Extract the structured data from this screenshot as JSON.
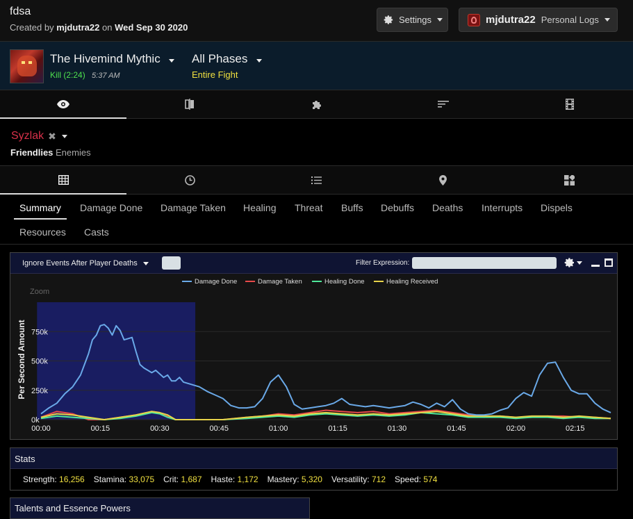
{
  "header": {
    "title": "fdsa",
    "created_prefix": "Created by",
    "created_user": "mjdutra22",
    "created_on": "on",
    "created_date": "Wed Sep 30 2020",
    "settings_label": "Settings",
    "user_name": "mjdutra22",
    "user_sub": "Personal Logs"
  },
  "fight": {
    "boss": "The Hivemind Mythic",
    "result": "Kill (2:24)",
    "time": "5:37 AM",
    "phase": "All Phases",
    "phase_sub": "Entire Fight"
  },
  "view_tabs": [
    "eye-icon",
    "compare-icon",
    "puzzle-icon",
    "sort-icon",
    "film-icon"
  ],
  "actor": {
    "name": "Syzlak",
    "friendlies": "Friendlies",
    "enemies": "Enemies"
  },
  "sub_tabs": [
    "grid-icon",
    "clock-icon",
    "list-icon",
    "map-marker-icon",
    "widgets-icon"
  ],
  "report_tabs": {
    "summary": "Summary",
    "damage_done": "Damage Done",
    "damage_taken": "Damage Taken",
    "healing": "Healing",
    "threat": "Threat",
    "buffs": "Buffs",
    "debuffs": "Debuffs",
    "deaths": "Deaths",
    "interrupts": "Interrupts",
    "dispels": "Dispels",
    "resources": "Resources",
    "casts": "Casts"
  },
  "graph": {
    "ignore_label": "Ignore Events After Player Deaths",
    "filter_label": "Filter Expression:",
    "filter_value": "",
    "zoom_label": "Zoom"
  },
  "chart_data": {
    "type": "line",
    "title": "",
    "xlabel": "",
    "ylabel": "Per Second Amount",
    "xlim": [
      0,
      144
    ],
    "ylim": [
      0,
      1000000
    ],
    "x_ticks": [
      "00:00",
      "00:15",
      "00:30",
      "00:45",
      "01:00",
      "01:15",
      "01:30",
      "01:45",
      "02:00",
      "02:15"
    ],
    "y_ticks": [
      "0k",
      "250k",
      "500k",
      "750k"
    ],
    "legend_position": "top",
    "zoom_range": [
      -1,
      39
    ],
    "series": [
      {
        "name": "Damage Done",
        "color": "#6aa9e8",
        "x": [
          0,
          2,
          4,
          6,
          8,
          10,
          12,
          13,
          14,
          15,
          16,
          17,
          18,
          19,
          20,
          21,
          22,
          23,
          24,
          25,
          26,
          27,
          28,
          29,
          30,
          31,
          32,
          33,
          34,
          35,
          36,
          38,
          40,
          42,
          44,
          46,
          48,
          50,
          52,
          54,
          56,
          58,
          60,
          62,
          64,
          66,
          68,
          70,
          72,
          74,
          76,
          78,
          80,
          82,
          84,
          86,
          88,
          90,
          92,
          94,
          96,
          98,
          100,
          102,
          104,
          106,
          108,
          110,
          112,
          114,
          116,
          118,
          120,
          122,
          124,
          126,
          128,
          130,
          132,
          134,
          136,
          138,
          140,
          142,
          144
        ],
        "y": [
          50000,
          100000,
          140000,
          220000,
          280000,
          380000,
          560000,
          680000,
          720000,
          800000,
          810000,
          780000,
          720000,
          800000,
          760000,
          680000,
          690000,
          700000,
          580000,
          470000,
          440000,
          420000,
          400000,
          420000,
          390000,
          360000,
          380000,
          330000,
          330000,
          360000,
          320000,
          300000,
          280000,
          240000,
          210000,
          180000,
          120000,
          100000,
          100000,
          110000,
          180000,
          320000,
          380000,
          280000,
          130000,
          90000,
          100000,
          110000,
          120000,
          140000,
          180000,
          130000,
          120000,
          110000,
          120000,
          110000,
          100000,
          110000,
          120000,
          150000,
          130000,
          100000,
          140000,
          110000,
          170000,
          90000,
          50000,
          40000,
          40000,
          50000,
          80000,
          100000,
          180000,
          230000,
          200000,
          380000,
          480000,
          490000,
          360000,
          250000,
          220000,
          220000,
          140000,
          90000,
          60000
        ]
      },
      {
        "name": "Damage Taken",
        "color": "#e84a4a",
        "x": [
          0,
          4,
          8,
          12,
          16,
          20,
          24,
          28,
          30,
          32,
          34,
          36,
          40,
          46,
          52,
          56,
          60,
          64,
          68,
          72,
          76,
          80,
          84,
          88,
          92,
          96,
          100,
          104,
          108,
          112,
          116,
          120,
          124,
          128,
          132,
          136,
          140,
          144
        ],
        "y": [
          20000,
          70000,
          50000,
          0,
          0,
          20000,
          40000,
          70000,
          60000,
          30000,
          0,
          0,
          0,
          0,
          20000,
          30000,
          50000,
          40000,
          60000,
          80000,
          70000,
          60000,
          70000,
          50000,
          60000,
          70000,
          80000,
          60000,
          40000,
          20000,
          30000,
          20000,
          20000,
          30000,
          30000,
          20000,
          20000,
          10000
        ]
      },
      {
        "name": "Healing Done",
        "color": "#4ee89a",
        "x": [
          0,
          4,
          8,
          12,
          16,
          20,
          24,
          28,
          30,
          32,
          34,
          36,
          40,
          46,
          52,
          56,
          60,
          64,
          68,
          72,
          76,
          80,
          84,
          88,
          92,
          96,
          100,
          104,
          108,
          112,
          116,
          120,
          124,
          128,
          132,
          136,
          140,
          144
        ],
        "y": [
          10000,
          30000,
          20000,
          10000,
          0,
          10000,
          30000,
          60000,
          50000,
          20000,
          0,
          0,
          0,
          0,
          10000,
          20000,
          30000,
          20000,
          40000,
          50000,
          40000,
          30000,
          40000,
          30000,
          40000,
          60000,
          50000,
          40000,
          20000,
          20000,
          20000,
          10000,
          20000,
          20000,
          10000,
          20000,
          10000,
          10000
        ]
      },
      {
        "name": "Healing Received",
        "color": "#e8d44a",
        "x": [
          0,
          4,
          8,
          12,
          16,
          20,
          24,
          28,
          30,
          32,
          34,
          36,
          40,
          46,
          52,
          56,
          60,
          64,
          68,
          72,
          76,
          80,
          84,
          88,
          92,
          96,
          100,
          104,
          108,
          112,
          116,
          120,
          124,
          128,
          132,
          136,
          140,
          144
        ],
        "y": [
          20000,
          50000,
          40000,
          20000,
          0,
          20000,
          40000,
          70000,
          60000,
          40000,
          0,
          0,
          0,
          0,
          20000,
          30000,
          40000,
          30000,
          50000,
          60000,
          50000,
          40000,
          50000,
          40000,
          50000,
          60000,
          70000,
          50000,
          30000,
          30000,
          30000,
          20000,
          30000,
          30000,
          20000,
          30000,
          20000,
          10000
        ]
      }
    ]
  },
  "stats": {
    "title": "Stats",
    "items": [
      {
        "label": "Strength:",
        "value": "16,256"
      },
      {
        "label": "Stamina:",
        "value": "33,075"
      },
      {
        "label": "Crit:",
        "value": "1,687"
      },
      {
        "label": "Haste:",
        "value": "1,172"
      },
      {
        "label": "Mastery:",
        "value": "5,320"
      },
      {
        "label": "Versatility:",
        "value": "712"
      },
      {
        "label": "Speed:",
        "value": "574"
      }
    ]
  },
  "talents": {
    "title": "Talents and Essence Powers"
  }
}
